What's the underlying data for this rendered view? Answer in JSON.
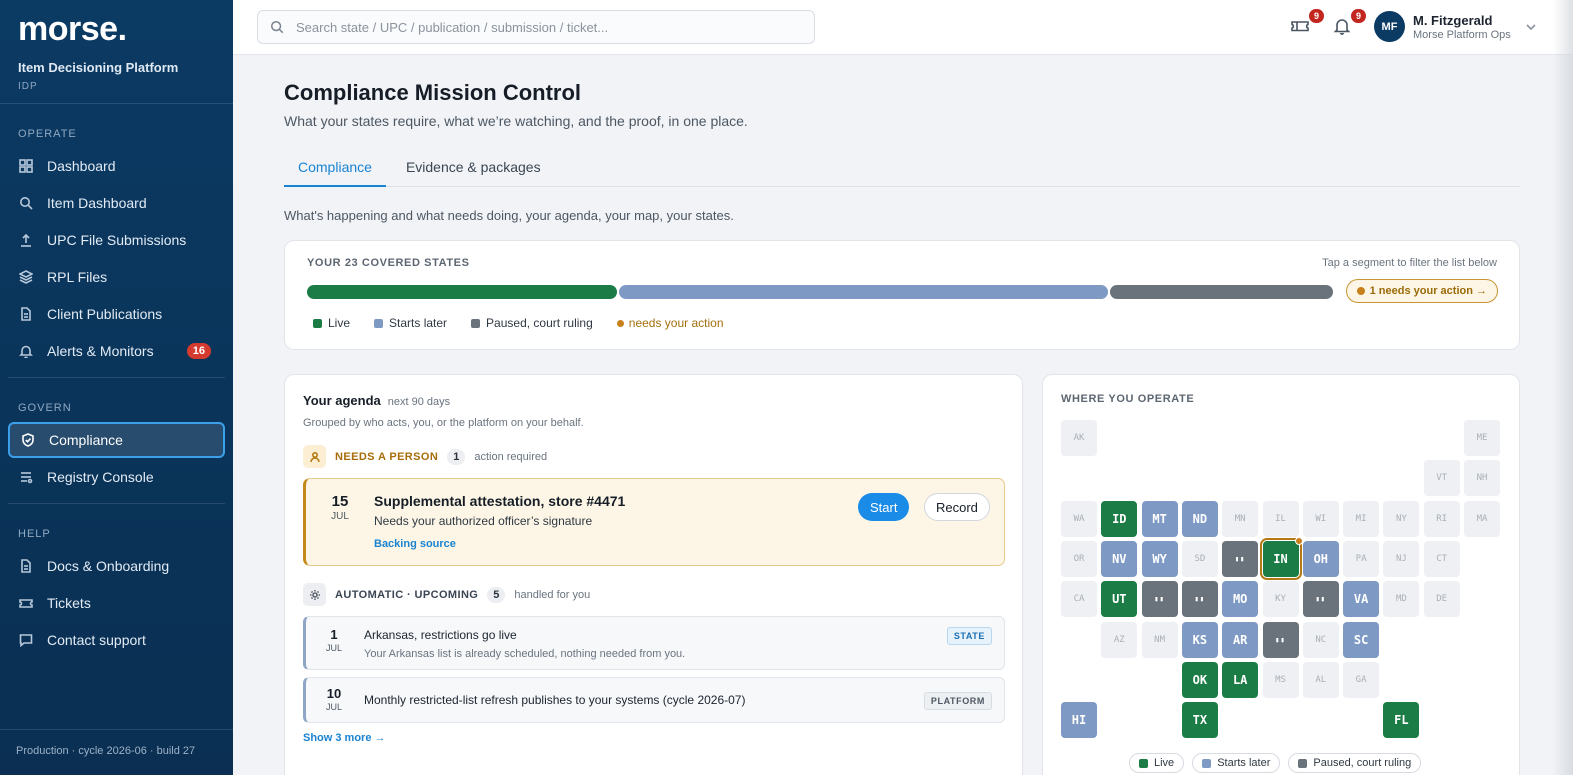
{
  "brand": {
    "logo": "morse",
    "logo_dot": ".",
    "subtitle": "Item Decisioning Platform",
    "code": "IDP"
  },
  "sidebar": {
    "sections": [
      {
        "heading": "OPERATE",
        "items": [
          {
            "label": "Dashboard",
            "icon": "grid-icon"
          },
          {
            "label": "Item Dashboard",
            "icon": "search-icon"
          },
          {
            "label": "UPC File Submissions",
            "icon": "upload-icon"
          },
          {
            "label": "RPL Files",
            "icon": "layers-icon"
          },
          {
            "label": "Client Publications",
            "icon": "document-icon"
          },
          {
            "label": "Alerts & Monitors",
            "icon": "bell-icon",
            "badge": "16"
          }
        ]
      },
      {
        "heading": "GOVERN",
        "items": [
          {
            "label": "Compliance",
            "icon": "shield-icon",
            "active": true
          },
          {
            "label": "Registry Console",
            "icon": "list-icon"
          }
        ]
      },
      {
        "heading": "HELP",
        "items": [
          {
            "label": "Docs & Onboarding",
            "icon": "document-icon"
          },
          {
            "label": "Tickets",
            "icon": "ticket-icon"
          },
          {
            "label": "Contact support",
            "icon": "chat-icon"
          }
        ]
      }
    ],
    "footer": "Production · cycle 2026-06 · build 27"
  },
  "topbar": {
    "search_placeholder": "Search state / UPC / publication / submission / ticket...",
    "tickets_badge": "9",
    "notifications_badge": "9",
    "user": {
      "initials": "MF",
      "name": "M. Fitzgerald",
      "org": "Morse Platform Ops"
    }
  },
  "page": {
    "title": "Compliance Mission Control",
    "subtitle": "What your states require, what we’re watching, and the proof, in one place.",
    "tabs": [
      "Compliance",
      "Evidence & packages"
    ],
    "intro": "What's happening and what needs doing, your agenda, your map, your states."
  },
  "coverage": {
    "title": "YOUR 23 COVERED STATES",
    "hint": "Tap a segment to filter the list below",
    "action_pill": "1 needs your action →",
    "segments": [
      {
        "key": "live",
        "fraction": 0.303,
        "color": "#1b7d45"
      },
      {
        "key": "later",
        "fraction": 0.479,
        "color": "#7e9ac4"
      },
      {
        "key": "paused",
        "fraction": 0.218,
        "color": "#6a727c"
      }
    ],
    "legend": {
      "live": "Live",
      "later": "Starts later",
      "paused": "Paused, court ruling",
      "action": "needs your action"
    },
    "colors": {
      "live": "#1b7d45",
      "later": "#7e9ac4",
      "paused": "#6a727c",
      "action": "#c8801c"
    }
  },
  "agenda": {
    "title": "Your agenda",
    "range": "next 90 days",
    "subtitle": "Grouped by who acts, you, or the platform on your behalf.",
    "person_group": {
      "title": "NEEDS A PERSON",
      "count": "1",
      "note": "action required"
    },
    "task": {
      "day": "15",
      "month": "JUL",
      "title": "Supplemental attestation, store #4471",
      "subtitle": "Needs your authorized officer’s signature",
      "link": "Backing source",
      "start": "Start",
      "record": "Record"
    },
    "auto_group": {
      "title": "AUTOMATIC · UPCOMING",
      "count": "5",
      "note": "handled for you"
    },
    "auto_items": [
      {
        "day": "1",
        "month": "JUL",
        "title": "Arkansas, restrictions go live",
        "subtitle": "Your Arkansas list is already scheduled, nothing needed from you.",
        "tag": "STATE"
      },
      {
        "day": "10",
        "month": "JUL",
        "title": "Monthly restricted-list refresh publishes to your systems (cycle 2026-07)",
        "tag": "PLATFORM"
      }
    ],
    "show_more": "Show 3 more →"
  },
  "map": {
    "title": "WHERE YOU OPERATE",
    "pause_glyph": "▮▮",
    "states": [
      {
        "code": "AK",
        "status": "off",
        "col": 0,
        "row": 0
      },
      {
        "code": "ME",
        "status": "off",
        "col": 10,
        "row": 0
      },
      {
        "code": "VT",
        "status": "off",
        "col": 9,
        "row": 1
      },
      {
        "code": "NH",
        "status": "off",
        "col": 10,
        "row": 1
      },
      {
        "code": "WA",
        "status": "off",
        "col": 0,
        "row": 2
      },
      {
        "code": "ID",
        "status": "live",
        "col": 1,
        "row": 2
      },
      {
        "code": "MT",
        "status": "later",
        "col": 2,
        "row": 2
      },
      {
        "code": "ND",
        "status": "later",
        "col": 3,
        "row": 2
      },
      {
        "code": "MN",
        "status": "off",
        "col": 4,
        "row": 2
      },
      {
        "code": "IL",
        "status": "off",
        "col": 5,
        "row": 2
      },
      {
        "code": "WI",
        "status": "off",
        "col": 6,
        "row": 2
      },
      {
        "code": "MI",
        "status": "off",
        "col": 7,
        "row": 2
      },
      {
        "code": "NY",
        "status": "off",
        "col": 8,
        "row": 2
      },
      {
        "code": "RI",
        "status": "off",
        "col": 9,
        "row": 2
      },
      {
        "code": "MA",
        "status": "off",
        "col": 10,
        "row": 2
      },
      {
        "code": "OR",
        "status": "off",
        "col": 0,
        "row": 3
      },
      {
        "code": "NV",
        "status": "later",
        "col": 1,
        "row": 3
      },
      {
        "code": "WY",
        "status": "later",
        "col": 2,
        "row": 3
      },
      {
        "code": "SD",
        "status": "off",
        "col": 3,
        "row": 3
      },
      {
        "code": "",
        "status": "paused",
        "col": 4,
        "row": 3
      },
      {
        "code": "IN",
        "status": "live",
        "col": 5,
        "row": 3,
        "selected": true
      },
      {
        "code": "OH",
        "status": "later",
        "col": 6,
        "row": 3
      },
      {
        "code": "PA",
        "status": "off",
        "col": 7,
        "row": 3
      },
      {
        "code": "NJ",
        "status": "off",
        "col": 8,
        "row": 3
      },
      {
        "code": "CT",
        "status": "off",
        "col": 9,
        "row": 3
      },
      {
        "code": "CA",
        "status": "off",
        "col": 0,
        "row": 4
      },
      {
        "code": "UT",
        "status": "live",
        "col": 1,
        "row": 4
      },
      {
        "code": "",
        "status": "paused",
        "col": 2,
        "row": 4
      },
      {
        "code": "",
        "status": "paused",
        "col": 3,
        "row": 4
      },
      {
        "code": "MO",
        "status": "later",
        "col": 4,
        "row": 4
      },
      {
        "code": "KY",
        "status": "off",
        "col": 5,
        "row": 4
      },
      {
        "code": "",
        "status": "paused",
        "col": 6,
        "row": 4
      },
      {
        "code": "VA",
        "status": "later",
        "col": 7,
        "row": 4
      },
      {
        "code": "MD",
        "status": "off",
        "col": 8,
        "row": 4
      },
      {
        "code": "DE",
        "status": "off",
        "col": 9,
        "row": 4
      },
      {
        "code": "AZ",
        "status": "off",
        "col": 1,
        "row": 5
      },
      {
        "code": "NM",
        "status": "off",
        "col": 2,
        "row": 5
      },
      {
        "code": "KS",
        "status": "later",
        "col": 3,
        "row": 5
      },
      {
        "code": "AR",
        "status": "later",
        "col": 4,
        "row": 5
      },
      {
        "code": "",
        "status": "paused",
        "col": 5,
        "row": 5
      },
      {
        "code": "NC",
        "status": "off",
        "col": 6,
        "row": 5
      },
      {
        "code": "SC",
        "status": "later",
        "col": 7,
        "row": 5
      },
      {
        "code": "OK",
        "status": "live",
        "col": 3,
        "row": 6
      },
      {
        "code": "LA",
        "status": "live",
        "col": 4,
        "row": 6
      },
      {
        "code": "MS",
        "status": "off",
        "col": 5,
        "row": 6
      },
      {
        "code": "AL",
        "status": "off",
        "col": 6,
        "row": 6
      },
      {
        "code": "GA",
        "status": "off",
        "col": 7,
        "row": 6
      },
      {
        "code": "HI",
        "status": "later",
        "col": 0,
        "row": 7
      },
      {
        "code": "TX",
        "status": "live",
        "col": 3,
        "row": 7
      },
      {
        "code": "FL",
        "status": "live",
        "col": 8,
        "row": 7
      }
    ],
    "legend": [
      "Live",
      "Starts later",
      "Paused, court ruling"
    ]
  }
}
